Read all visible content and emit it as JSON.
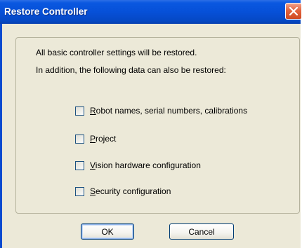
{
  "window": {
    "title": "Restore Controller"
  },
  "content": {
    "line1": "All basic controller settings will be restored.",
    "line2": "In addition, the following data can also be restored:"
  },
  "options": [
    {
      "mnemonic": "R",
      "rest": "obot names, serial numbers, calibrations",
      "checked": false
    },
    {
      "mnemonic": "P",
      "rest": "roject",
      "checked": false
    },
    {
      "mnemonic": "V",
      "rest": "ision hardware configuration",
      "checked": false
    },
    {
      "mnemonic": "S",
      "rest": "ecurity configuration",
      "checked": false
    }
  ],
  "buttons": {
    "ok_label": "OK",
    "cancel_label": "Cancel"
  },
  "colors": {
    "titlebar": "#0650d8",
    "dialog_bg": "#ece9d8",
    "close_button": "#e2643f"
  },
  "icons": {
    "close": "close-icon"
  }
}
